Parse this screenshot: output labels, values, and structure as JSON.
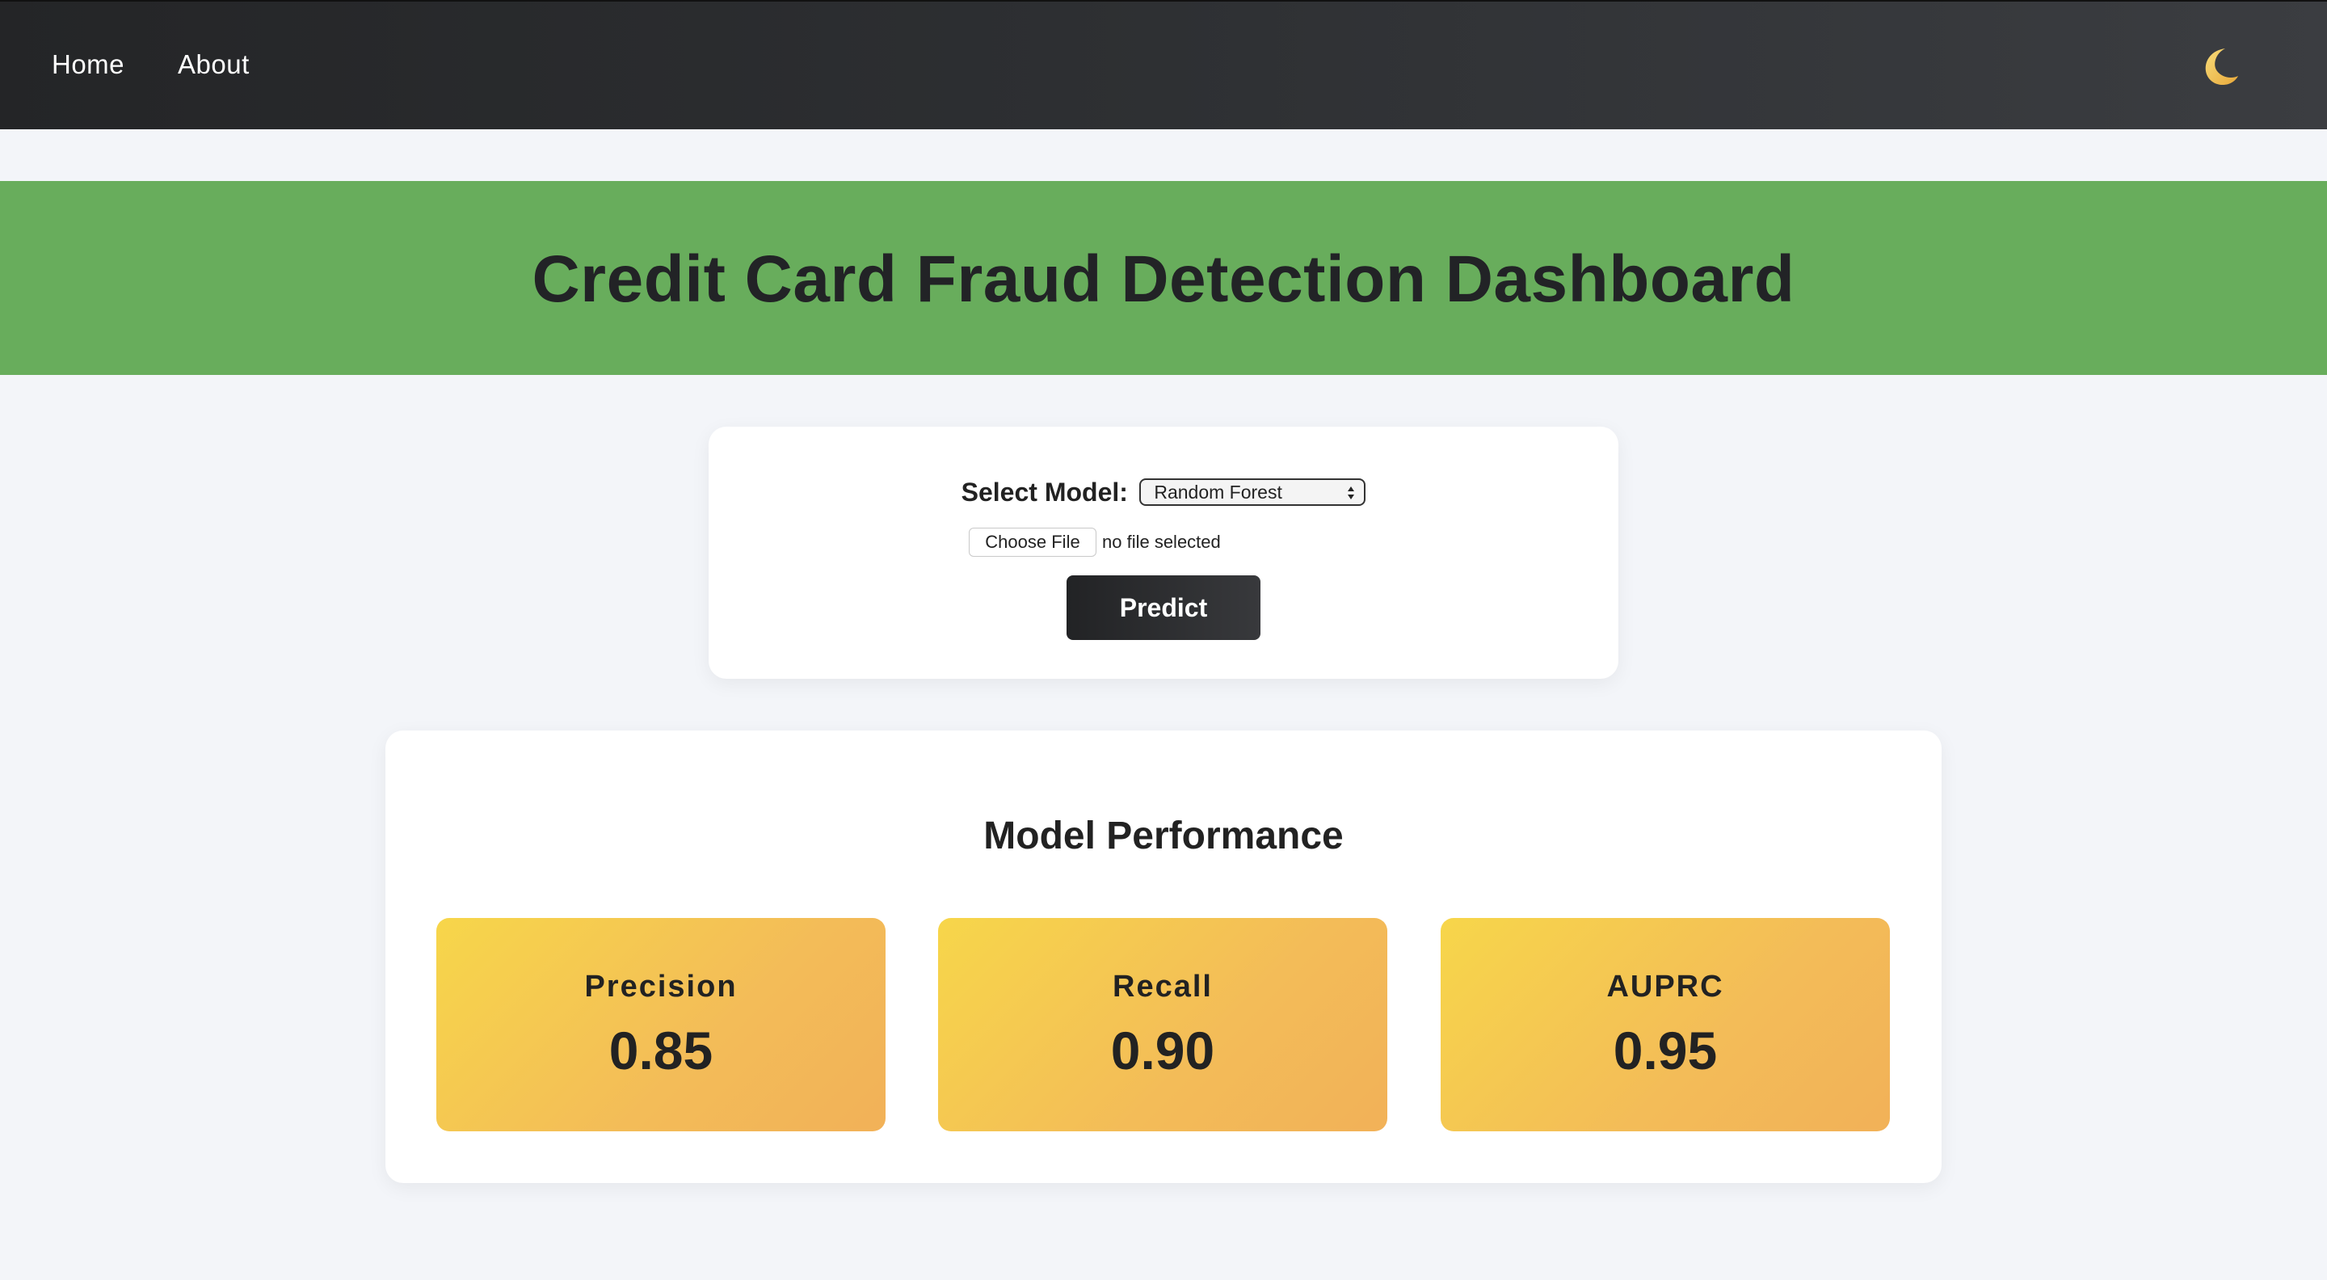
{
  "nav": {
    "home": "Home",
    "about": "About",
    "theme_icon": "crescent-moon-icon",
    "theme_icon_color": "#f2c04a"
  },
  "banner": {
    "title": "Credit Card Fraud Detection Dashboard",
    "background": "#68ad5c"
  },
  "form": {
    "model_label": "Select Model:",
    "model_selected": "Random Forest",
    "choose_file_label": "Choose File",
    "file_status": "no file selected",
    "predict_label": "Predict"
  },
  "performance": {
    "title": "Model Performance",
    "metrics": [
      {
        "name": "Precision",
        "value": "0.85"
      },
      {
        "name": "Recall",
        "value": "0.90"
      },
      {
        "name": "AUPRC",
        "value": "0.95"
      }
    ]
  }
}
